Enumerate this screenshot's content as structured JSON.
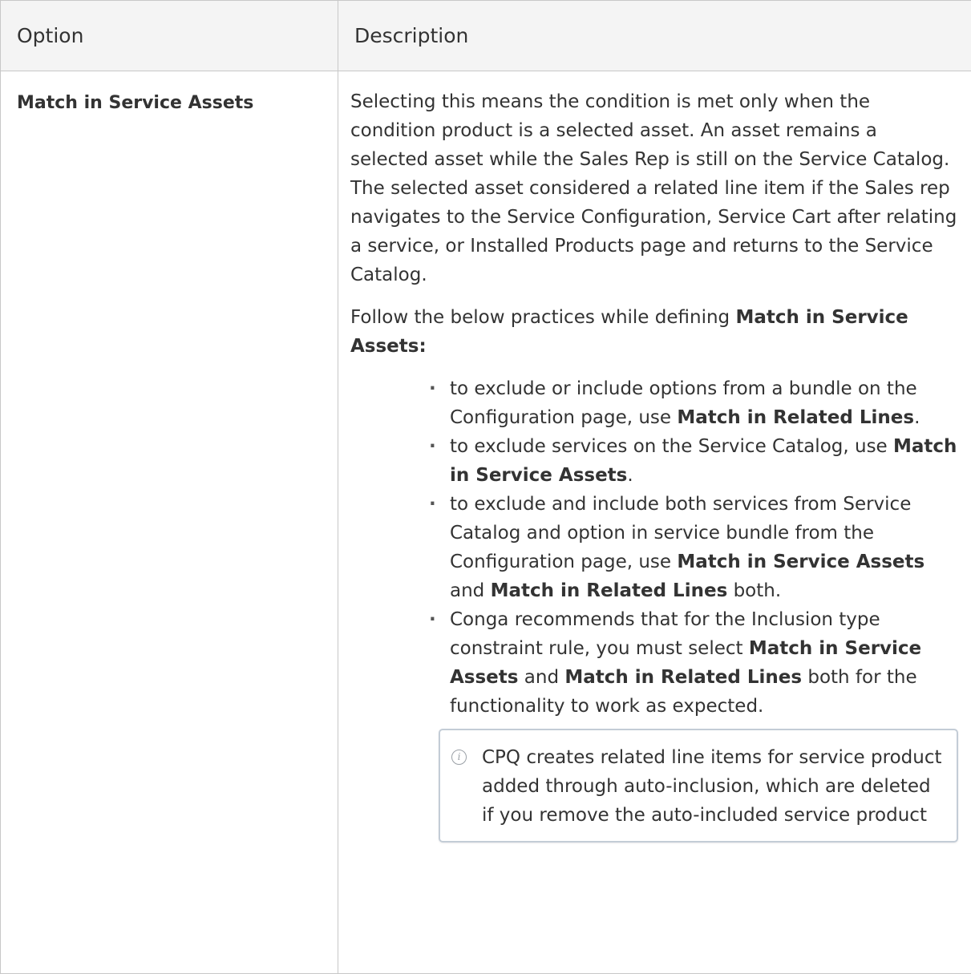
{
  "table": {
    "headers": [
      "Option",
      "Description"
    ],
    "rows": [
      {
        "option": "Match in Service Assets",
        "paragraph1": "Selecting this means the condition is met only when the condition product is a selected asset. An asset remains a selected asset while the Sales Rep is still on the Service Catalog. The selected asset considered a related line item if the Sales rep navigates to the Service Configuration, Service Cart after relating a service, or Installed Products page and returns to the Service Catalog.",
        "paragraph2": {
          "text": "Follow the below practices while defining ",
          "bold": "Match in Service Assets:"
        },
        "bullets": [
          {
            "t1": "to exclude or include options from a bundle on the Configuration page, use ",
            "b1": "Match in Related Lines",
            "t2": "."
          },
          {
            "t1": "to exclude services on the Service Catalog, use ",
            "b1": "Match in Service Assets",
            "t2": "."
          },
          {
            "t1": "to exclude and include both services from Service Catalog and option in service bundle from the Configuration page, use ",
            "b1": "Match in Service Assets",
            "t2": " and ",
            "b2": "Match in Related Lines",
            "t3": " both."
          },
          {
            "t1": "Conga recommends that for the Inclusion type constraint rule, you must select ",
            "b1": "Match in Service Assets",
            "t2": " and ",
            "b2": "Match in Related Lines",
            "t3": " both for the functionality to work as expected."
          }
        ],
        "note": {
          "icon": "info-icon",
          "text": "CPQ creates related line items for service product added through auto-inclusion, which are deleted if you remove the auto-included service product"
        }
      }
    ]
  }
}
